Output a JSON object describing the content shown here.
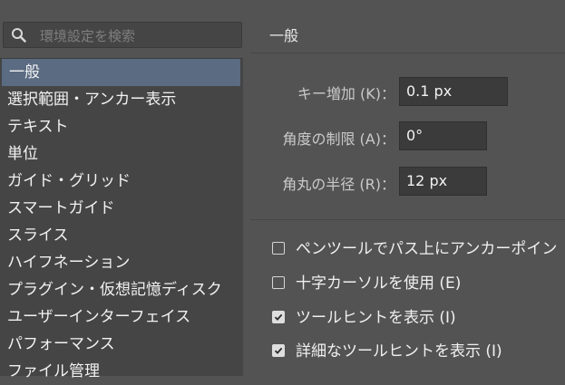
{
  "search": {
    "placeholder": "環境設定を検索",
    "icon": "search-icon"
  },
  "categories": [
    {
      "label": "一般",
      "selected": true
    },
    {
      "label": "選択範囲・アンカー表示"
    },
    {
      "label": "テキスト"
    },
    {
      "label": "単位"
    },
    {
      "label": "ガイド・グリッド"
    },
    {
      "label": "スマートガイド"
    },
    {
      "label": "スライス"
    },
    {
      "label": "ハイフネーション"
    },
    {
      "label": "プラグイン・仮想記憶ディスク"
    },
    {
      "label": "ユーザーインターフェイス"
    },
    {
      "label": "パフォーマンス"
    },
    {
      "label": "ファイル管理"
    }
  ],
  "general": {
    "title": "一般",
    "fields": [
      {
        "label": "キー増加 (K)：",
        "value": "0.1 px"
      },
      {
        "label": "角度の制限 (A)：",
        "value": "0°"
      },
      {
        "label": "角丸の半径 (R)：",
        "value": "12 px"
      }
    ],
    "checkboxes": [
      {
        "label": "ペンツールでパス上にアンカーポイン",
        "checked": false
      },
      {
        "label": "十字カーソルを使用 (E)",
        "checked": false
      },
      {
        "label": "ツールヒントを表示 (I)",
        "checked": true
      },
      {
        "label": "詳細なツールヒントを表示 (I)",
        "checked": true
      }
    ]
  },
  "colors": {
    "panel_bg": "#535353",
    "list_bg": "#454545",
    "selection": "#5a6b82",
    "input_bg": "#3b3b3b"
  }
}
